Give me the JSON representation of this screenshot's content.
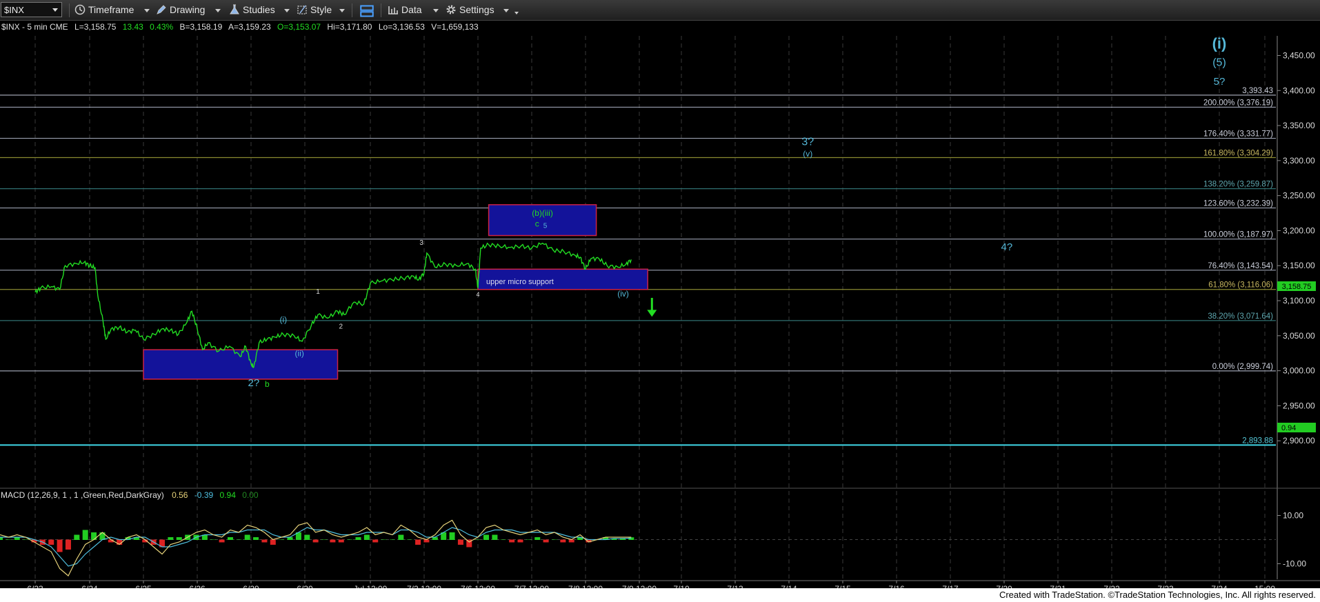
{
  "toolbar": {
    "symbol": "$INX",
    "items": [
      {
        "label": "Timeframe",
        "icon": "clock-icon"
      },
      {
        "label": "Drawing",
        "icon": "pencil-icon"
      },
      {
        "label": "Studies",
        "icon": "flask-icon"
      },
      {
        "label": "Style",
        "icon": "style-icon"
      },
      {
        "label": "",
        "icon": "layout-icon"
      },
      {
        "label": "Data",
        "icon": "bars-icon"
      },
      {
        "label": "Settings",
        "icon": "gear-icon"
      }
    ]
  },
  "header": {
    "title": "$INX - 5 min  CME",
    "last": "L=3,158.75",
    "change": "13.43",
    "pct": "0.43%",
    "bid": "B=3,158.19",
    "ask": "A=3,159.23",
    "open": "O=3,153.07",
    "high": "Hi=3,171.80",
    "low": "Lo=3,136.53",
    "volume": "V=1,659,133"
  },
  "macd": {
    "label": "MACD (12,26,9, 1 , 1 ,Green,Red,DarkGray)",
    "v1": "0.56",
    "v2": "-0.39",
    "v3": "0.94",
    "v4": "0.00",
    "current_tag": "0.94",
    "ticks": [
      "10.00",
      "-10.00"
    ]
  },
  "price_tag": "3,158.75",
  "footer_text": "Created with TradeStation. ©TradeStation Technologies, Inc. All rights reserved.",
  "colors": {
    "price": "#22dd22",
    "wave": "#55b8d8",
    "fib_line": "#8a8fa0",
    "box_fill": "#13139a",
    "box_border": "#cc2244",
    "arrow": "#22dd22"
  },
  "chart_data": {
    "type": "line",
    "title": "$INX - 5 min",
    "y_axis": {
      "range": [
        2850,
        3480
      ],
      "ticks": [
        2900,
        2950,
        3000,
        3050,
        3100,
        3150,
        3200,
        3250,
        3300,
        3350,
        3400,
        3450
      ],
      "tick_labels": [
        "2,900.00",
        "2,950.00",
        "3,000.00",
        "3,050.00",
        "3,100.00",
        "3,150.00",
        "3,200.00",
        "3,250.00",
        "3,300.00",
        "3,350.00",
        "3,400.00",
        "3,450.00"
      ]
    },
    "x_axis": {
      "tick_labels": [
        "6/23",
        "6/24",
        "6/25",
        "6/26",
        "6/29",
        "6/30",
        "Jul 12:00",
        "7/2 12:00",
        "7/6 12:00",
        "7/7 12:00",
        "7/8 12:00",
        "7/9 12:00",
        "7/10",
        "7/13",
        "7/14",
        "7/15",
        "7/16",
        "7/17",
        "7/20",
        "7/21",
        "7/22",
        "7/23",
        "7/24",
        "15:00"
      ],
      "positions": [
        0,
        1,
        2,
        3,
        4,
        5,
        6,
        7,
        8,
        9,
        10,
        11,
        12,
        13,
        14,
        15,
        16,
        17,
        18,
        19,
        20,
        21,
        22,
        23
      ]
    },
    "series": [
      {
        "x": [
          0,
          0.1,
          0.3,
          0.45,
          0.55,
          0.75,
          0.9,
          1.0,
          1.1,
          1.15,
          1.25,
          1.3,
          1.4,
          1.55,
          1.7,
          1.85,
          2.0,
          2.2,
          2.35,
          2.5,
          2.65,
          2.8,
          2.9,
          3.0,
          3.1,
          3.2,
          3.4,
          3.6,
          3.8,
          3.9,
          4.0,
          4.05,
          4.15,
          4.3,
          4.45,
          4.6,
          4.8,
          4.95,
          5.1,
          5.2,
          5.35,
          5.5,
          5.6,
          5.75,
          5.9,
          6.0,
          6.2,
          6.4,
          6.6,
          6.8,
          6.9,
          7.0,
          7.05,
          7.2,
          7.4,
          7.6,
          7.8,
          7.95,
          8.0,
          8.05,
          8.2,
          8.4,
          8.6,
          8.8,
          9.0,
          9.2,
          9.4,
          9.6,
          9.8,
          9.9,
          10.0,
          10.1,
          10.25,
          10.4,
          10.6,
          10.75,
          10.85
        ],
        "values": [
          3112,
          3118,
          3120,
          3116,
          3150,
          3153,
          3155,
          3150,
          3147,
          3108,
          3070,
          3045,
          3060,
          3062,
          3055,
          3058,
          3045,
          3052,
          3060,
          3058,
          3052,
          3068,
          3085,
          3060,
          3030,
          3040,
          3028,
          3035,
          3020,
          3035,
          3010,
          3005,
          3040,
          3045,
          3048,
          3052,
          3050,
          3042,
          3065,
          3080,
          3075,
          3085,
          3080,
          3098,
          3095,
          3125,
          3128,
          3130,
          3132,
          3135,
          3130,
          3140,
          3168,
          3148,
          3152,
          3150,
          3153,
          3145,
          3118,
          3175,
          3180,
          3178,
          3176,
          3178,
          3175,
          3182,
          3172,
          3170,
          3165,
          3162,
          3145,
          3160,
          3160,
          3150,
          3148,
          3152,
          3158.75
        ]
      }
    ],
    "fib_levels": [
      {
        "label": "200.00% (3,376.19)",
        "value": 3376.19
      },
      {
        "label": "176.40% (3,331.77)",
        "value": 3331.77
      },
      {
        "label": "161.80% (3,304.29)",
        "value": 3304.29
      },
      {
        "label": "138.20% (3,259.87)",
        "value": 3259.87
      },
      {
        "label": "123.60% (3,232.39)",
        "value": 3232.39
      },
      {
        "label": "100.00% (3,187.97)",
        "value": 3187.97
      },
      {
        "label": "76.40% (3,143.54)",
        "value": 3143.54
      },
      {
        "label": "61.80% (3,116.06)",
        "value": 3116.06
      },
      {
        "label": "38.20% (3,071.64)",
        "value": 3071.64
      },
      {
        "label": "0.00% (2,999.74)",
        "value": 2999.74
      }
    ],
    "price_levels": [
      {
        "label": "3,393.43",
        "value": 3393.43
      },
      {
        "label": "2,893.88",
        "value": 2893.88
      }
    ],
    "zones": [
      {
        "label": "",
        "x": [
          2.0,
          5.5
        ],
        "y": [
          2988,
          3030
        ]
      },
      {
        "label": "",
        "x": [
          8.2,
          10.2
        ],
        "y": [
          3193,
          3237
        ]
      },
      {
        "label": "upper micro support",
        "x": [
          8.0,
          11.2
        ],
        "y": [
          3116,
          3145
        ]
      }
    ],
    "wave_labels": [
      {
        "text": "(i)",
        "x": 22.0,
        "y": 3460,
        "color": "#55b8d8",
        "size": 22,
        "bold": true
      },
      {
        "text": "(5)",
        "x": 22.0,
        "y": 3435,
        "color": "#55b8d8",
        "size": 16
      },
      {
        "text": "5?",
        "x": 22.0,
        "y": 3408,
        "color": "#55b8d8",
        "size": 15
      },
      {
        "text": "3?",
        "x": 14.35,
        "y": 3322,
        "color": "#55b8d8",
        "size": 16
      },
      {
        "text": "(v)",
        "x": 14.35,
        "y": 3306,
        "color": "#55b8d8",
        "size": 12
      },
      {
        "text": "4?",
        "x": 18.05,
        "y": 3172,
        "color": "#55b8d8",
        "size": 15
      },
      {
        "text": "(b)(iii)",
        "x": 9.2,
        "y": 3221,
        "color": "#22dd22",
        "size": 12
      },
      {
        "text": "c",
        "x": 9.1,
        "y": 3206,
        "color": "#22dd22",
        "size": 12
      },
      {
        "text": "5",
        "x": 9.25,
        "y": 3204,
        "color": "#55b8d8",
        "size": 10
      },
      {
        "text": "3",
        "x": 6.95,
        "y": 3180,
        "color": "#dddddd",
        "size": 10
      },
      {
        "text": "1",
        "x": 5.2,
        "y": 3110,
        "color": "#dddddd",
        "size": 10
      },
      {
        "text": "2",
        "x": 5.55,
        "y": 3060,
        "color": "#dddddd",
        "size": 10
      },
      {
        "text": "4",
        "x": 8.0,
        "y": 3106,
        "color": "#dddddd",
        "size": 9
      },
      {
        "text": "(i)",
        "x": 4.6,
        "y": 3069,
        "color": "#55b8d8",
        "size": 12
      },
      {
        "text": "(ii)",
        "x": 4.9,
        "y": 3021,
        "color": "#55b8d8",
        "size": 12
      },
      {
        "text": "(iv)",
        "x": 10.7,
        "y": 3106,
        "color": "#55b8d8",
        "size": 12
      },
      {
        "text": "2?",
        "x": 4.05,
        "y": 2978,
        "color": "#55b8d8",
        "size": 15
      },
      {
        "text": "b",
        "x": 4.3,
        "y": 2977,
        "color": "#22dd22",
        "size": 12
      }
    ],
    "arrow": {
      "x": 11.3,
      "y_from": 3104,
      "y_to": 3080
    },
    "macd": {
      "macd_line": [
        2,
        1,
        2,
        1,
        -1,
        -3,
        -5,
        -12,
        -15,
        -8,
        -2,
        0,
        3,
        0,
        -2,
        1,
        2,
        0,
        -3,
        -6,
        -2,
        -1,
        1,
        3,
        4,
        2,
        1,
        4,
        3,
        6,
        5,
        3,
        0,
        1,
        2,
        6,
        7,
        3,
        4,
        2,
        1,
        2,
        3,
        5,
        2,
        3,
        2,
        6,
        4,
        1,
        0,
        2,
        6,
        8,
        2,
        -1,
        1,
        5,
        6,
        4,
        3,
        2,
        3,
        4,
        2,
        3,
        1,
        0,
        2,
        -1,
        0,
        1,
        1,
        1,
        1
      ],
      "signal_line": [
        1,
        1,
        1,
        1,
        0,
        -1,
        -3,
        -7,
        -11,
        -10,
        -6,
        -3,
        0,
        1,
        0,
        0,
        1,
        1,
        -1,
        -3,
        -3,
        -2,
        -1,
        1,
        2,
        2,
        2,
        3,
        3,
        4,
        4,
        4,
        2,
        1,
        1,
        3,
        5,
        4,
        4,
        3,
        2,
        2,
        2,
        3,
        3,
        3,
        2,
        4,
        4,
        3,
        1,
        1,
        3,
        5,
        4,
        2,
        1,
        3,
        4,
        4,
        4,
        3,
        3,
        3,
        3,
        3,
        2,
        1,
        1,
        0,
        0,
        0,
        0.5,
        0.5,
        0.56
      ],
      "histogram": [
        1,
        0,
        1,
        0,
        -1,
        -2,
        -2,
        -5,
        -4,
        2,
        4,
        3,
        3,
        -1,
        -2,
        1,
        1,
        -1,
        -2,
        -3,
        1,
        1,
        2,
        2,
        2,
        0,
        -1,
        1,
        0,
        2,
        1,
        -1,
        -2,
        0,
        1,
        3,
        2,
        -1,
        0,
        -1,
        -1,
        0,
        1,
        2,
        -1,
        0,
        0,
        2,
        0,
        -2,
        -1,
        1,
        3,
        3,
        -2,
        -3,
        0,
        2,
        2,
        0,
        -1,
        -1,
        0,
        1,
        -1,
        0,
        -1,
        -1,
        1,
        -1,
        0,
        1,
        0.5,
        0.5,
        0.94
      ]
    }
  }
}
